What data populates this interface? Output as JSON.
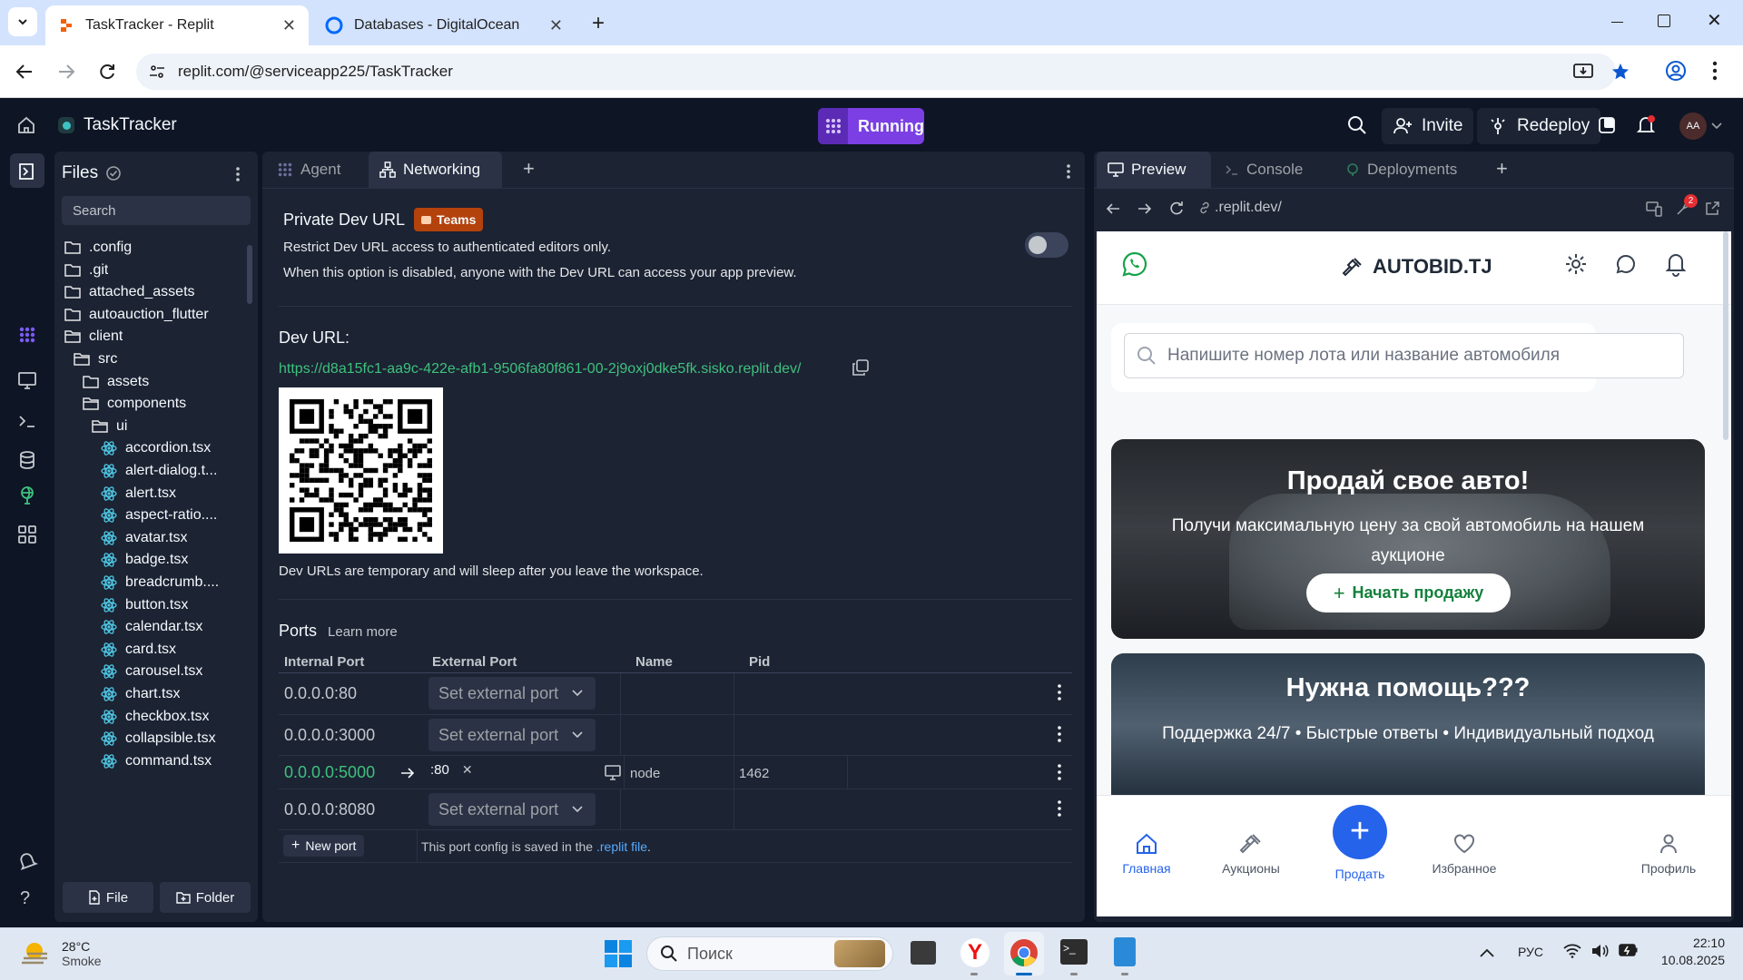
{
  "browser": {
    "tabs": [
      {
        "title": "TaskTracker - Replit",
        "active": true
      },
      {
        "title": "Databases - DigitalOcean",
        "active": false
      }
    ],
    "url": "replit.com/@serviceapp225/TaskTracker"
  },
  "replit": {
    "project_name": "TaskTracker",
    "run_status": "Running",
    "invite_label": "Invite",
    "redeploy_label": "Redeploy",
    "avatar_initials": "AA"
  },
  "files": {
    "title": "Files",
    "search_placeholder": "Search",
    "items": [
      {
        "name": ".config",
        "type": "folder",
        "depth": 0
      },
      {
        "name": ".git",
        "type": "folder",
        "depth": 0
      },
      {
        "name": "attached_assets",
        "type": "folder",
        "depth": 0
      },
      {
        "name": "autoauction_flutter",
        "type": "folder",
        "depth": 0
      },
      {
        "name": "client",
        "type": "folder-open",
        "depth": 0
      },
      {
        "name": "src",
        "type": "folder-open",
        "depth": 1
      },
      {
        "name": "assets",
        "type": "folder",
        "depth": 2
      },
      {
        "name": "components",
        "type": "folder-open",
        "depth": 2
      },
      {
        "name": "ui",
        "type": "folder-open",
        "depth": 3
      },
      {
        "name": "accordion.tsx",
        "type": "react",
        "depth": 4
      },
      {
        "name": "alert-dialog.t...",
        "type": "react",
        "depth": 4
      },
      {
        "name": "alert.tsx",
        "type": "react",
        "depth": 4
      },
      {
        "name": "aspect-ratio....",
        "type": "react",
        "depth": 4
      },
      {
        "name": "avatar.tsx",
        "type": "react",
        "depth": 4
      },
      {
        "name": "badge.tsx",
        "type": "react",
        "depth": 4
      },
      {
        "name": "breadcrumb....",
        "type": "react",
        "depth": 4
      },
      {
        "name": "button.tsx",
        "type": "react",
        "depth": 4
      },
      {
        "name": "calendar.tsx",
        "type": "react",
        "depth": 4
      },
      {
        "name": "card.tsx",
        "type": "react",
        "depth": 4
      },
      {
        "name": "carousel.tsx",
        "type": "react",
        "depth": 4
      },
      {
        "name": "chart.tsx",
        "type": "react",
        "depth": 4
      },
      {
        "name": "checkbox.tsx",
        "type": "react",
        "depth": 4
      },
      {
        "name": "collapsible.tsx",
        "type": "react",
        "depth": 4
      },
      {
        "name": "command.tsx",
        "type": "react",
        "depth": 4
      }
    ],
    "new_file_label": "File",
    "new_folder_label": "Folder"
  },
  "center_tabs": [
    "Agent",
    "Networking"
  ],
  "networking": {
    "private_title": "Private Dev URL",
    "teams_badge": "Teams",
    "private_desc1": "Restrict Dev URL access to authenticated editors only.",
    "private_desc2": "When this option is disabled, anyone with the Dev URL can access your app preview.",
    "toggle_on": false,
    "dev_url_label": "Dev URL:",
    "dev_url": "https://d8a15fc1-aa9c-422e-afb1-9506fa80f861-00-2j9oxj0dke5fk.sisko.replit.dev/",
    "dev_url_note": "Dev URLs are temporary and will sleep after you leave the workspace.",
    "ports_title": "Ports",
    "learn_more": "Learn more",
    "columns": [
      "Internal Port",
      "External Port",
      "Name",
      "Pid"
    ],
    "ports": [
      {
        "internal": "0.0.0.0:80",
        "external": "Set external port",
        "name": "",
        "pid": "",
        "active": false
      },
      {
        "internal": "0.0.0.0:3000",
        "external": "Set external port",
        "name": "",
        "pid": "",
        "active": false
      },
      {
        "internal": "0.0.0.0:5000",
        "external": ":80",
        "name": "node",
        "pid": "1462",
        "active": true
      },
      {
        "internal": "0.0.0.0:8080",
        "external": "Set external port",
        "name": "",
        "pid": "",
        "active": false
      }
    ],
    "new_port_label": "New port",
    "config_note_prefix": "This port config is saved in the",
    "config_note_link": ".replit file",
    "config_note_suffix": "."
  },
  "preview_tabs": [
    "Preview",
    "Console",
    "Deployments"
  ],
  "preview": {
    "url": ".replit.dev/",
    "notification_count": "2"
  },
  "app": {
    "brand": "AUTOBID.TJ",
    "search_placeholder": "Напишите номер лота или название автомобиля",
    "hero_title": "Продай свое авто!",
    "hero_subtitle": "Получи максимальную цену за свой автомобиль на нашем аукционе",
    "hero_button": "Начать продажу",
    "help_title": "Нужна помощь???",
    "help_subtitle": "Поддержка 24/7 • Быстрые ответы • Индивидуальный подход",
    "nav": [
      {
        "label": "Главная",
        "icon": "home-icon",
        "active": true
      },
      {
        "label": "Аукционы",
        "icon": "gavel-icon",
        "active": false
      },
      {
        "label": "Продать",
        "icon": "plus-icon",
        "active": false
      },
      {
        "label": "Избранное",
        "icon": "heart-icon",
        "active": false
      },
      {
        "label": "Профиль",
        "icon": "user-icon",
        "active": false
      }
    ],
    "colors": {
      "primary": "#2563eb",
      "whatsapp": "#16a34a"
    }
  },
  "taskbar": {
    "weather_temp": "28°C",
    "weather_desc": "Smoke",
    "search_placeholder": "Поиск",
    "language": "РУС",
    "time": "22:10",
    "date": "10.08.2025"
  }
}
